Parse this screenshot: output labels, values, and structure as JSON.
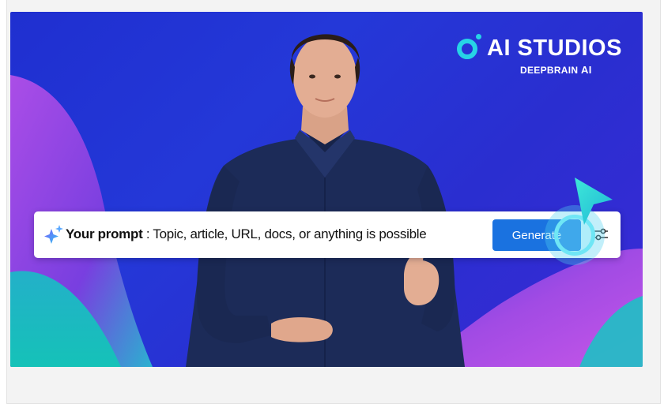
{
  "logo": {
    "title": "AI STUDIOS",
    "subtitle_prefix": "DEEPBRAIN ",
    "subtitle_suffix": "AI"
  },
  "prompt": {
    "label": "Your prompt",
    "separator": " : ",
    "placeholder": "Topic, article, URL, docs, or anything is possible",
    "generate_label": "Generate"
  },
  "colors": {
    "background": "#2438d8",
    "accent_cyan": "#27d3e6",
    "button_blue": "#1a72e0",
    "wave_purple": "#a64ce0",
    "wave_teal": "#1fb5c8"
  },
  "icons": [
    "sparkle-icon",
    "settings-sliders-icon",
    "cursor-arrow-icon"
  ]
}
